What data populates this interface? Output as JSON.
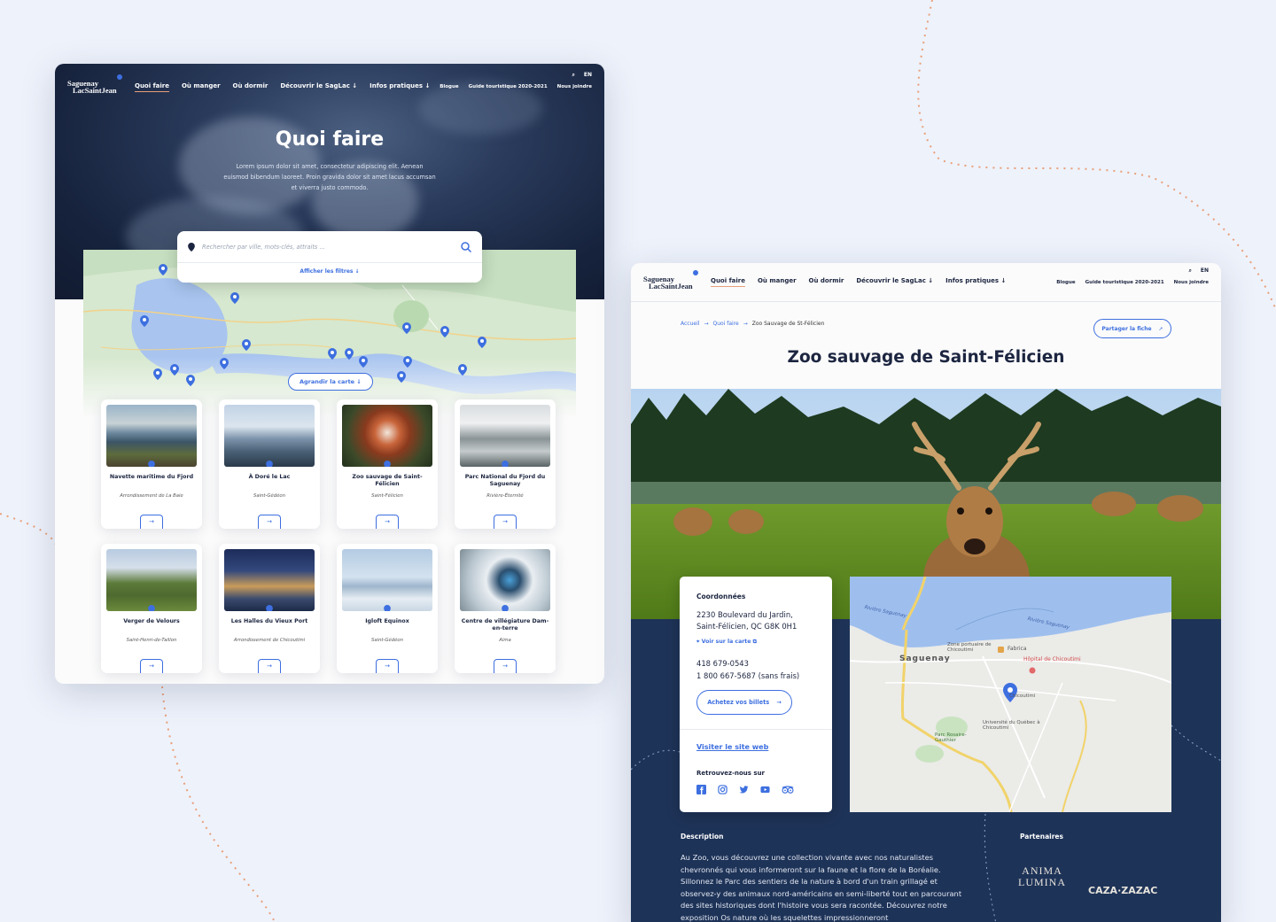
{
  "brand": {
    "logo_line1": "Saguenay",
    "logo_line2": "LacSaintJean"
  },
  "nav": {
    "items": [
      "Quoi faire",
      "Où manger",
      "Où dormir",
      "Découvrir le SagLac ↓",
      "Infos pratiques ↓"
    ],
    "util": [
      "Blogue",
      "Guide touristique 2020-2021",
      "Nous joindre"
    ],
    "lang": "EN"
  },
  "list_page": {
    "title": "Quoi faire",
    "intro": "Lorem ipsum dolor sit amet, consectetur adipiscing elit. Aenean euismod bibendum laoreet. Proin gravida dolor sit amet lacus accumsan et viverra justo commodo.",
    "search_placeholder": "Rechercher par ville, mots-clés, attraits ...",
    "filters_label": "Afficher les filtres  ↓",
    "enlarge_map": "Agrandir la carte  ↓",
    "cards": [
      {
        "title": "Navette maritime du Fjord",
        "sub": "Arrondissement de La Baie"
      },
      {
        "title": "À Doré le Lac",
        "sub": "Saint-Gédéon"
      },
      {
        "title": "Zoo sauvage de Saint-Félicien",
        "sub": "Saint-Félicien"
      },
      {
        "title": "Parc National du Fjord du Saguenay",
        "sub": "Rivière-Éternité"
      },
      {
        "title": "Verger de Velours",
        "sub": "Saint-Henri-de-Taillon"
      },
      {
        "title": "Les Halles du Vieux Port",
        "sub": "Arrondissement de Chicoutimi"
      },
      {
        "title": "Igloft Equinox",
        "sub": "Saint-Gédéon"
      },
      {
        "title": "Centre de villégiature Dam-en-terre",
        "sub": "Alma"
      }
    ],
    "arrow": "→"
  },
  "detail_page": {
    "breadcrumb": [
      "Accueil",
      "Quoi faire",
      "Zoo Sauvage de St-Félicien"
    ],
    "breadcrumb_sep": "→",
    "share_label": "Partager la fiche",
    "title": "Zoo sauvage de Saint-Félicien",
    "coords_heading": "Coordonnées",
    "address_line1": "2230 Boulevard du Jardin,",
    "address_line2": "Saint-Félicien, QC G8K 0H1",
    "map_link": "Voir sur la carte",
    "phone1": "418 679-0543",
    "phone2": "1 800 667-5687 (sans frais)",
    "tickets": "Achetez vos billets",
    "website": "Visiter le site web",
    "social_heading": "Retrouvez-nous sur",
    "map_labels": {
      "city": "Saguenay",
      "river": "Rivière Saguenay",
      "river2": "Rivière Saguenay",
      "port": "Zone portuaire de Chicoutimi",
      "fabrica": "Fabrica",
      "hospital": "Hôpital de Chicoutimi",
      "uqac": "Université du Québec à Chicoutimi",
      "park": "Parc Rosaire-Gauthier",
      "chicoutimi": "Chicoutimi"
    },
    "desc_heading": "Description",
    "description": "Au Zoo, vous découvrez une collection vivante avec nos naturalistes chevronnés qui vous informeront sur la faune et la flore de la Boréalie. Sillonnez le Parc des sentiers de la nature à bord d'un train grillagé et observez-y des animaux nord-américains en semi-liberté tout en parcourant des sites historiques dont l'histoire vous sera racontée. Découvrez notre exposition Os nature où les squelettes impressionneront",
    "partners_heading": "Partenaires",
    "partner1": "ANIMA LUMINA",
    "partner2": "CAZA·ZAZAC"
  },
  "colors": {
    "accent": "#3d6fe0",
    "navy": "#1e3358",
    "orange": "#e8a07a"
  }
}
